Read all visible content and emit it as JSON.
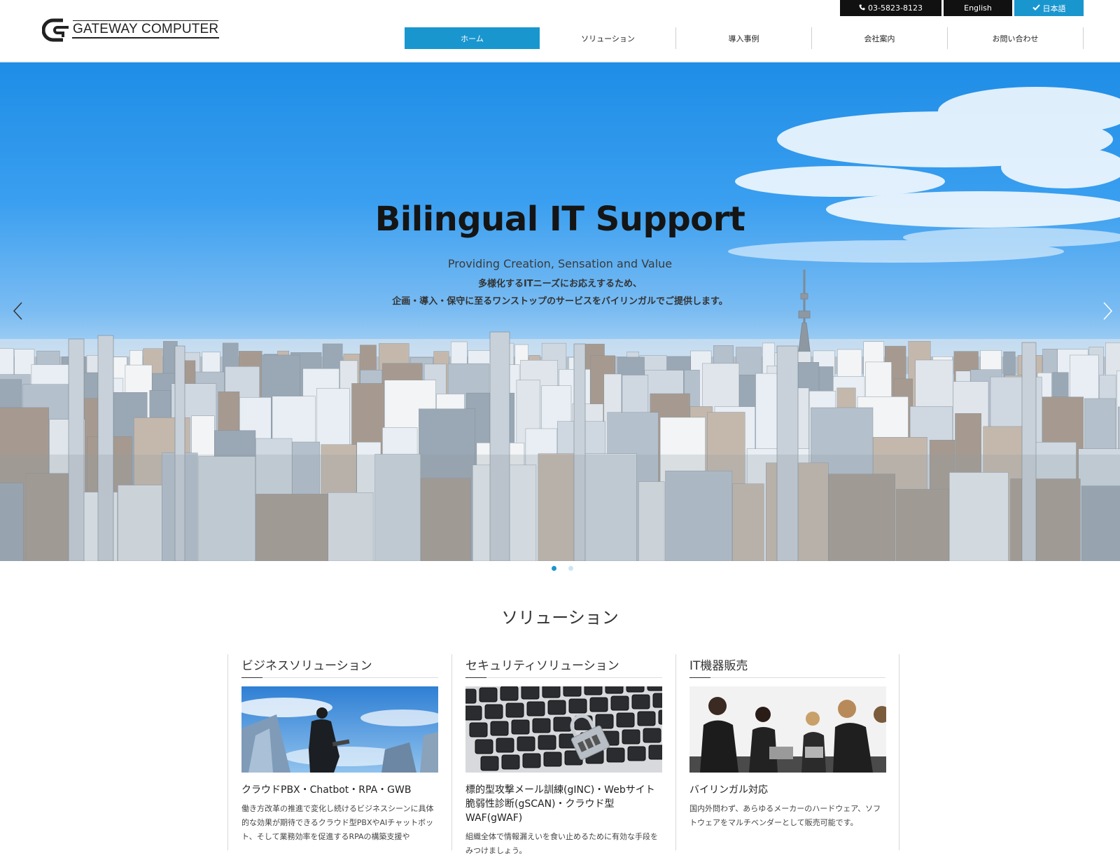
{
  "header": {
    "logo_text": "GATEWAY COMPUTER",
    "phone": "03-5823-8123",
    "lang_english": "English",
    "lang_japanese": "日本語",
    "nav": [
      "ホーム",
      "ソリューション",
      "導入事例",
      "会社案内",
      "お問い合わせ"
    ],
    "nav_active_index": 0
  },
  "hero": {
    "title": "Bilingual IT Support",
    "subtitle": "Providing Creation, Sensation and Value",
    "line1": "多様化するITニーズにお応えするため、",
    "line2": "企画・導入・保守に至るワンストップのサービスをバイリンガルでご提供します。",
    "slide_count": 2,
    "active_slide": 0
  },
  "solutions": {
    "title": "ソリューション",
    "items": [
      {
        "title": "ビジネスソリューション",
        "image": "businessman-building-photo",
        "subtitle": "クラウドPBX・Chatbot・RPA・GWB",
        "description": "働き方改革の推進で変化し続けるビジネスシーンに具体的な効果が期待できるクラウド型PBXやAIチャットボット、そして業務効率を促進するRPAの構築支援や"
      },
      {
        "title": "セキュリティソリューション",
        "image": "keyboard-padlock-photo",
        "subtitle": "標的型攻撃メール訓練(gINC)・Webサイト脆弱性診断(gSCAN)・クラウド型WAF(gWAF)",
        "description": "組織全体で情報漏えいを食い止めるために有効な手段をみつけましょう。"
      },
      {
        "title": "IT機器販売",
        "image": "business-meeting-photo",
        "subtitle": "バイリンガル対応",
        "description": "国内外問わず、あらゆるメーカーのハードウェア、ソフトウェアをマルチベンダーとして販売可能です。"
      }
    ]
  },
  "colors": {
    "accent": "#1a96cf",
    "topbar_dark": "#111111"
  }
}
